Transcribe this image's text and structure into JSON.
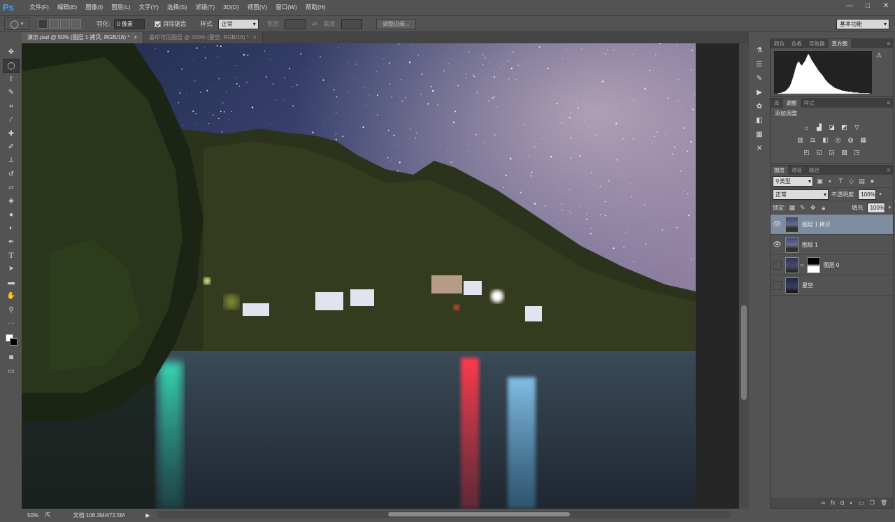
{
  "app": {
    "logo": "Ps",
    "menu": [
      "文件(F)",
      "编辑(E)",
      "图像(I)",
      "图层(L)",
      "文字(Y)",
      "选择(S)",
      "滤镜(T)",
      "3D(D)",
      "视图(V)",
      "窗口(W)",
      "帮助(H)"
    ],
    "window_buttons": [
      "—",
      "□",
      "✕"
    ]
  },
  "options": {
    "feather_label": "羽化:",
    "feather_value": "0 像素",
    "antialias_label": "消除锯齿",
    "style_label": "样式:",
    "style_value": "正常",
    "width_label": "宽度:",
    "height_label": "高度:",
    "refine_edge_label": "调整边缘...",
    "workspace_value": "基本功能"
  },
  "documents": {
    "tabs": [
      {
        "label": "演示.psd @ 50% (图层 1 拷贝, RGB/16) *"
      },
      {
        "label": "盖印可见图层 @ 200% (星空, RGB/16) *"
      }
    ]
  },
  "status": {
    "zoom": "50%",
    "doc_info": "文档:106.3M/472.5M"
  },
  "panels": {
    "histogram": {
      "tabs": [
        "颜色",
        "色板",
        "导航器",
        "直方图"
      ],
      "active_tab": 3,
      "levels": [
        0,
        0,
        0,
        1,
        1,
        2,
        3,
        4,
        6,
        9,
        12,
        18,
        26,
        35,
        45,
        52,
        55,
        50,
        48,
        52,
        56,
        62,
        68,
        64,
        58,
        54,
        50,
        46,
        42,
        38,
        35,
        32,
        28,
        24,
        21,
        18,
        16,
        14,
        12,
        10,
        9,
        8,
        7,
        6,
        5,
        5,
        4,
        4,
        3,
        3,
        3,
        2,
        2,
        2,
        2,
        1,
        1,
        1,
        1,
        1,
        1,
        1,
        0,
        0
      ]
    },
    "adjustments": {
      "tabs": [
        "库",
        "调整",
        "样式"
      ],
      "active_tab": 1,
      "title": "添加调整",
      "row1": [
        "brightness-icon",
        "levels-icon",
        "curves-icon",
        "exposure-icon",
        "vibrance-icon"
      ],
      "row2": [
        "hue-saturation-icon",
        "color-balance-icon",
        "black-white-icon",
        "photo-filter-icon",
        "channel-mixer-icon",
        "color-lookup-icon"
      ],
      "row3": [
        "invert-icon",
        "posterize-icon",
        "threshold-icon",
        "gradient-map-icon",
        "selective-color-icon"
      ]
    },
    "layers": {
      "tabs": [
        "图层",
        "通道",
        "路径"
      ],
      "active_tab": 0,
      "filter_kind": "类型",
      "blend_mode": "正常",
      "opacity_label": "不透明度:",
      "opacity_value": "100%",
      "lock_label": "锁定:",
      "fill_label": "填充:",
      "fill_value": "100%",
      "items": [
        {
          "name": "图层 1 拷贝",
          "visible": true,
          "selected": true,
          "has_mask": false
        },
        {
          "name": "图层 1",
          "visible": true,
          "selected": false,
          "has_mask": false
        },
        {
          "name": "图层 0",
          "visible": false,
          "selected": false,
          "has_mask": true
        },
        {
          "name": "星空",
          "visible": false,
          "selected": false,
          "has_mask": false
        }
      ]
    }
  }
}
